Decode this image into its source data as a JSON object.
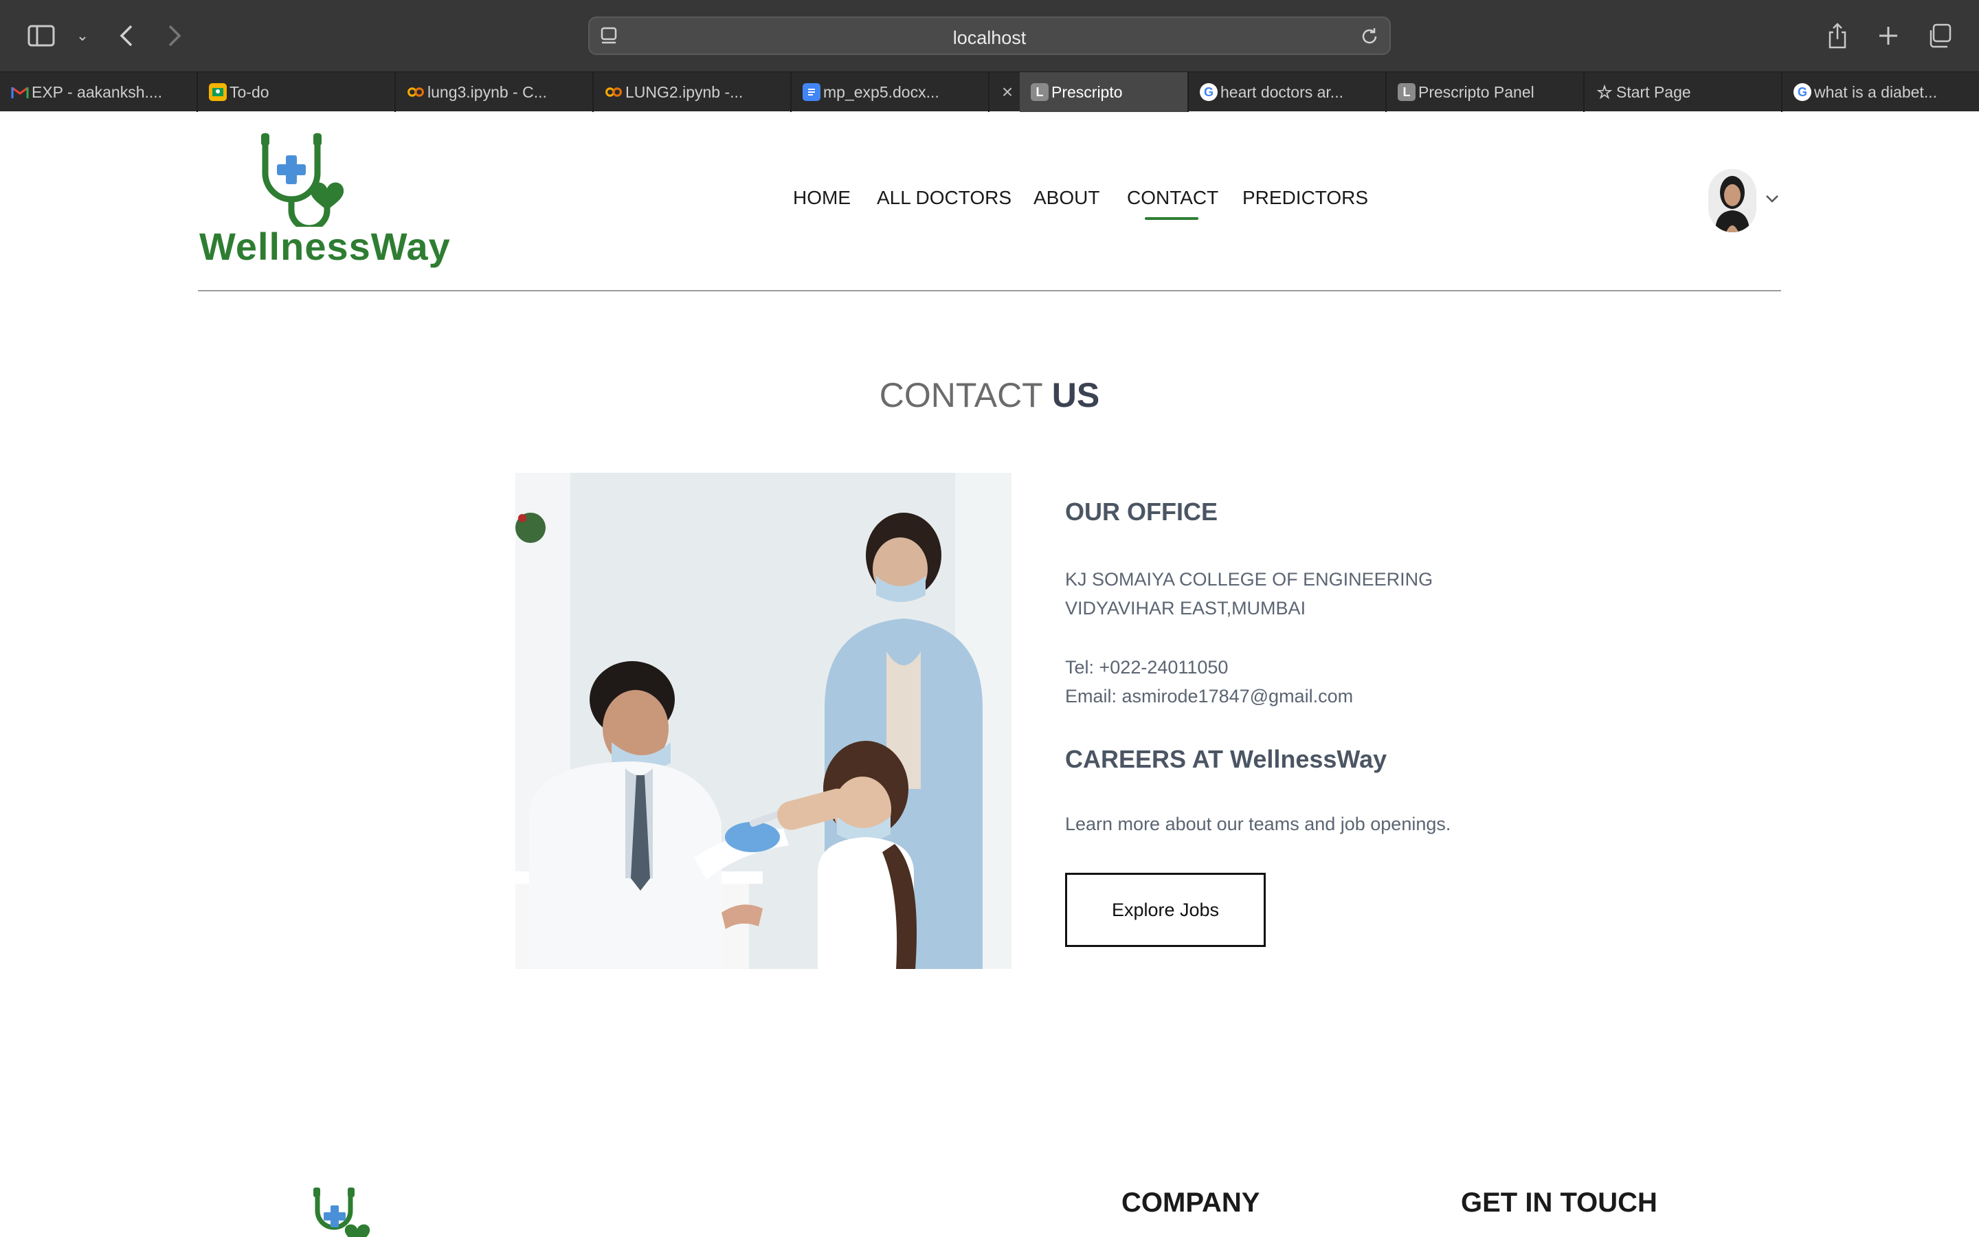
{
  "browser": {
    "url": "localhost",
    "tabs": [
      {
        "label": "EXP - aakanksh....",
        "favicon": "gmail-icon"
      },
      {
        "label": "To-do",
        "favicon": "classroom-icon"
      },
      {
        "label": "lung3.ipynb - C...",
        "favicon": "colab-icon"
      },
      {
        "label": "LUNG2.ipynb -...",
        "favicon": "colab-icon"
      },
      {
        "label": "mp_exp5.docx...",
        "favicon": "docs-icon"
      },
      {
        "label": "Prescripto",
        "favicon": "L",
        "active": true
      },
      {
        "label": "heart doctors ar...",
        "favicon": "google-icon"
      },
      {
        "label": "Prescripto Panel",
        "favicon": "L"
      },
      {
        "label": "Start Page",
        "favicon": "star-icon"
      },
      {
        "label": "what is a diabet...",
        "favicon": "google-icon"
      }
    ]
  },
  "header": {
    "brand": "WellnessWay",
    "nav": [
      "HOME",
      "ALL DOCTORS",
      "ABOUT",
      "CONTACT",
      "PREDICTORS"
    ],
    "active_nav": "CONTACT"
  },
  "main": {
    "title_light": "CONTACT",
    "title_bold": "US",
    "office_heading": "OUR OFFICE",
    "address_line1": "KJ SOMAIYA COLLEGE OF ENGINEERING",
    "address_line2": "VIDYAVIHAR EAST,MUMBAI",
    "tel": "Tel: +022-24011050",
    "email": "Email: asmirode17847@gmail.com",
    "careers_heading": "CAREERS AT WellnessWay",
    "careers_text": "Learn more about our teams and job openings.",
    "explore_button": "Explore Jobs"
  },
  "footer": {
    "company_heading": "COMPANY",
    "contact_heading": "GET IN TOUCH"
  },
  "colors": {
    "brand_green": "#2e7d32",
    "cross_blue": "#4a90d9",
    "chrome_dark": "#373737"
  }
}
